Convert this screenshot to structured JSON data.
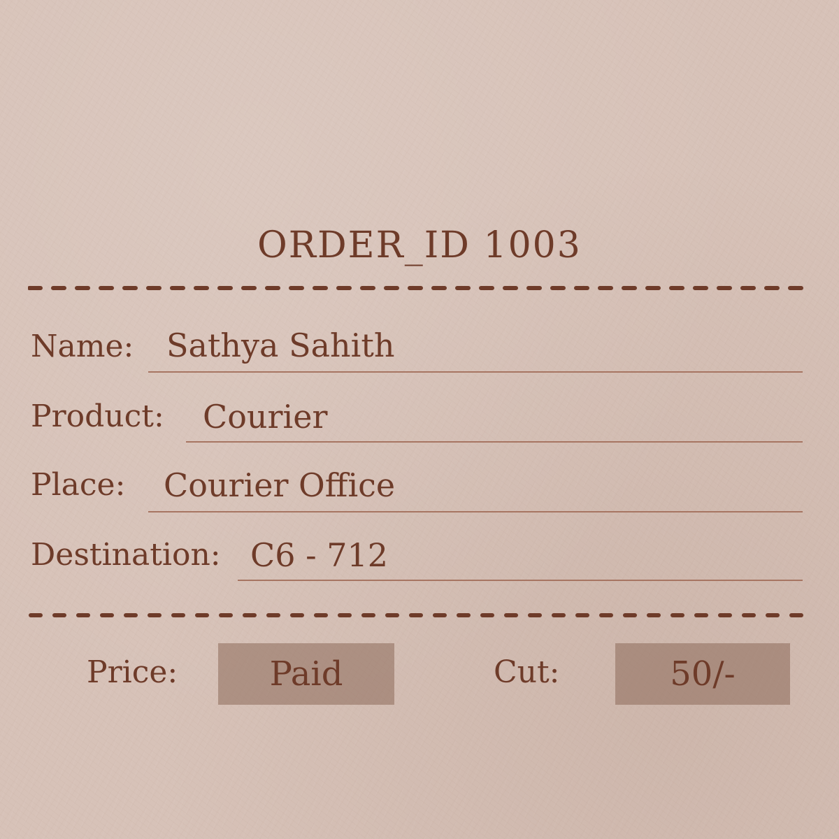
{
  "order": {
    "title": "ORDER_ID 1003"
  },
  "fields": {
    "name_label": "Name:",
    "name_value": "Sathya Sahith",
    "product_label": "Product:",
    "product_value": "Courier",
    "place_label": "Place:",
    "place_value": "Courier Office",
    "destination_label": "Destination:",
    "destination_value": "C6 - 712"
  },
  "payment": {
    "price_label": "Price:",
    "price_value": "Paid",
    "cut_label": "Cut:",
    "cut_value": "50/-"
  },
  "colors": {
    "paper": "#d7c2b8",
    "ink": "#6e3b29",
    "rule": "#a77562",
    "box": "#a88a7c"
  }
}
